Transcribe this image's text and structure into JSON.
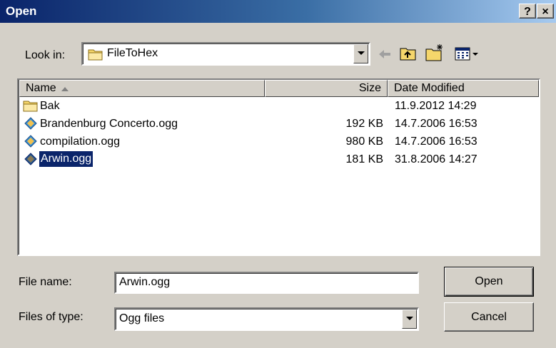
{
  "window": {
    "title": "Open",
    "help_label": "?",
    "close_label": "×"
  },
  "lookin": {
    "label": "Look in:",
    "value": "FileToHex"
  },
  "list": {
    "columns": {
      "name": "Name",
      "size": "Size",
      "date": "Date Modified"
    },
    "rows": [
      {
        "name": "Bak",
        "size": "",
        "date": "11.9.2012 14:29",
        "icon": "folder-icon"
      },
      {
        "name": "Brandenburg Concerto.ogg",
        "size": "192 KB",
        "date": "14.7.2006 16:53",
        "icon": "ogg-file-icon"
      },
      {
        "name": "compilation.ogg",
        "size": "980 KB",
        "date": "14.7.2006 16:53",
        "icon": "ogg-file-icon"
      },
      {
        "name": "Arwin.ogg",
        "size": "181 KB",
        "date": "31.8.2006 14:27",
        "icon": "ogg-file-icon",
        "selected": true
      }
    ]
  },
  "filename": {
    "label": "File name:",
    "value": "Arwin.ogg"
  },
  "filetype": {
    "label": "Files of type:",
    "value": "Ogg files"
  },
  "buttons": {
    "open": "Open",
    "cancel": "Cancel"
  },
  "colors": {
    "title_start": "#0a246a",
    "title_end": "#a6caf0",
    "selection": "#0a246a",
    "face": "#d4d0c8"
  }
}
